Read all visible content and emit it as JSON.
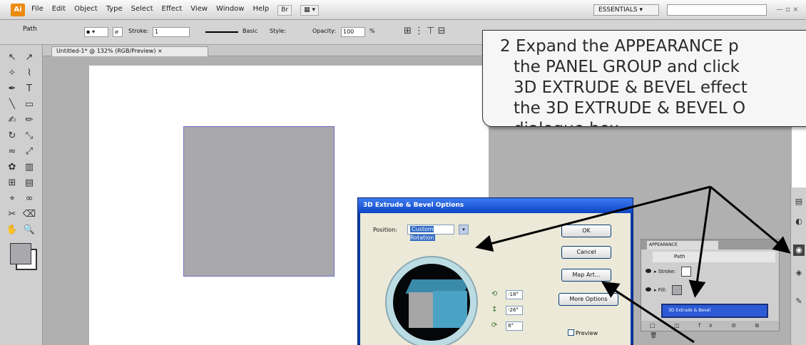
{
  "app": {
    "logo": "Ai",
    "menu": [
      "File",
      "Edit",
      "Object",
      "Type",
      "Select",
      "Effect",
      "View",
      "Window",
      "Help"
    ],
    "workspace": "ESSENTIALS",
    "window_controls": "— ▫ ×"
  },
  "control_bar": {
    "path_label": "Path",
    "stroke_label": "Stroke:",
    "stroke_value": "1",
    "stroke_profile": "Basic",
    "style_label": "Style:",
    "opacity_label": "Opacity:",
    "opacity_value": "100",
    "opacity_unit": "%"
  },
  "document_tab": "Untitled-1* @ 132% (RGB/Preview)",
  "toolbox_icons": [
    "selection-icon",
    "direct-selection-icon",
    "magic-wand-icon",
    "lasso-icon",
    "pen-icon",
    "type-icon",
    "line-icon",
    "rectangle-icon",
    "paintbrush-icon",
    "pencil-icon",
    "rotate-icon",
    "scale-icon",
    "warp-icon",
    "free-transform-icon",
    "symbol-sprayer-icon",
    "graph-icon",
    "mesh-icon",
    "gradient-icon",
    "eyedropper-icon",
    "blend-icon",
    "slice-icon",
    "eraser-icon",
    "hand-icon",
    "zoom-icon"
  ],
  "callout": {
    "lines": [
      "2 Expand the APPEARANCE p",
      "the PANEL GROUP and click",
      "3D EXTRUDE & BEVEL effect",
      "the 3D EXTRUDE & BEVEL O",
      "dialogue box."
    ]
  },
  "dialog": {
    "title": "3D Extrude & Bevel Options",
    "position_label": "Position:",
    "position_value": "Custom Rotation",
    "rotation": {
      "x": "-18°",
      "y": "-26°",
      "z": "8°"
    },
    "buttons": {
      "ok": "OK",
      "cancel": "Cancel",
      "map_art": "Map Art...",
      "more_options": "More Options"
    },
    "preview_label": "Preview"
  },
  "appearance_panel": {
    "tab": "APPEARANCE",
    "path_label": "Path",
    "rows": [
      "Stroke:",
      "Fill:"
    ],
    "effect": "3D Extrude & Bevel",
    "footer_icons": "□ ◫ fx ⊘ ⧉ 🗑"
  },
  "colors": {
    "menubar": "#d6d6d6",
    "dialog_title": "#0d45c6",
    "square_fill": "#a9a9ad",
    "cube_front": "#4aa2c4",
    "highlight": "#2d5bd6"
  }
}
